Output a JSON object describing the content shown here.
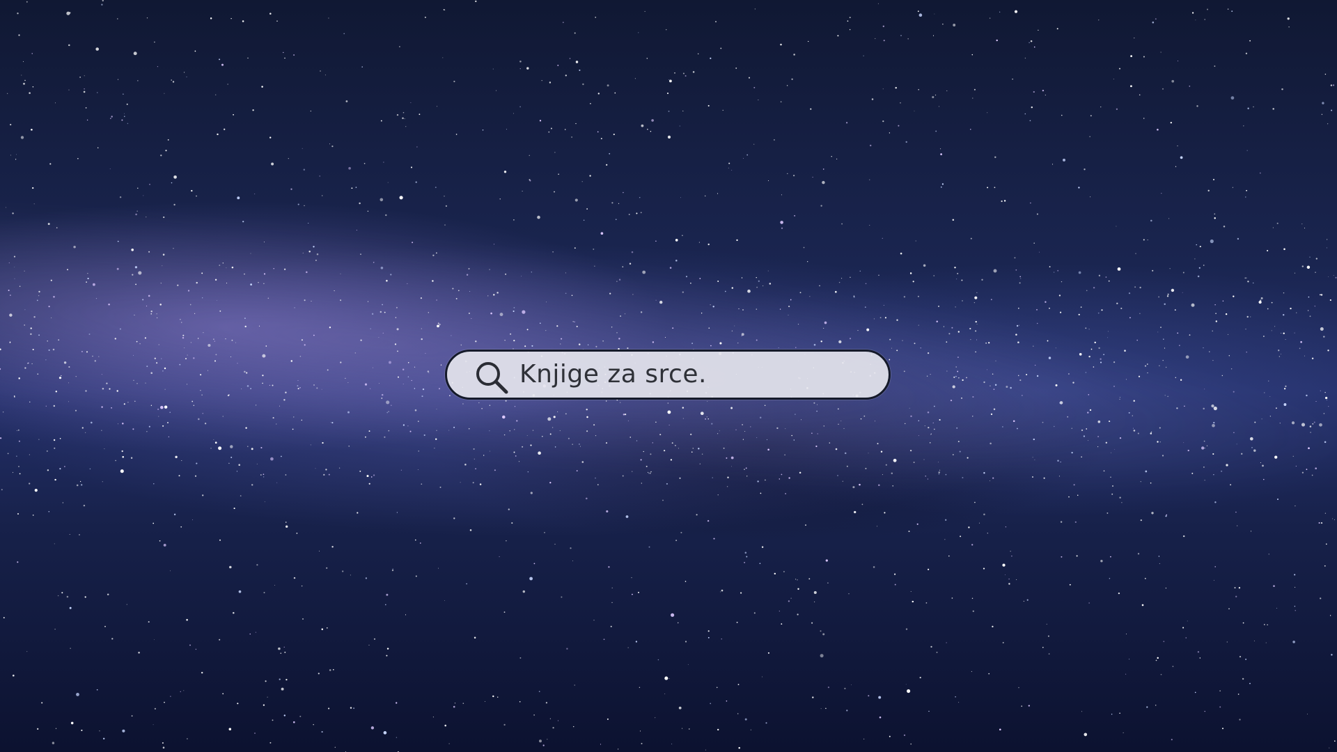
{
  "background": {
    "description_colors": {
      "sky_dark": "#0f1530",
      "sky_mid": "#24306a",
      "milky_way": "#8f84c8"
    }
  },
  "search": {
    "value": "Knjige za srce.",
    "icon": "search-icon",
    "background": "#e8e8ee",
    "border": "#151a2a",
    "text_color": "#2f3138"
  }
}
